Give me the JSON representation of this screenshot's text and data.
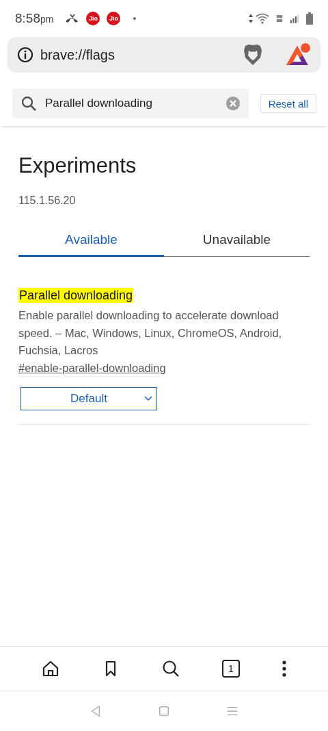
{
  "status_bar": {
    "time": "8:58",
    "ampm": "pm",
    "carrier_badges": [
      "Jio",
      "Jio"
    ],
    "dot": "•"
  },
  "address_bar": {
    "url": "brave://flags"
  },
  "search": {
    "value": "Parallel downloading",
    "reset_label": "Reset all"
  },
  "page": {
    "title": "Experiments",
    "version": "115.1.56.20"
  },
  "tabs": [
    {
      "label": "Available",
      "selected": true
    },
    {
      "label": "Unavailable",
      "selected": false
    }
  ],
  "flags": [
    {
      "name": "Parallel downloading",
      "description": "Enable parallel downloading to accelerate download speed. – Mac, Windows, Linux, ChromeOS, Android, Fuchsia, Lacros",
      "link": "#enable-parallel-downloading",
      "value": "Default"
    }
  ],
  "bottom_nav": {
    "tab_count": "1"
  }
}
